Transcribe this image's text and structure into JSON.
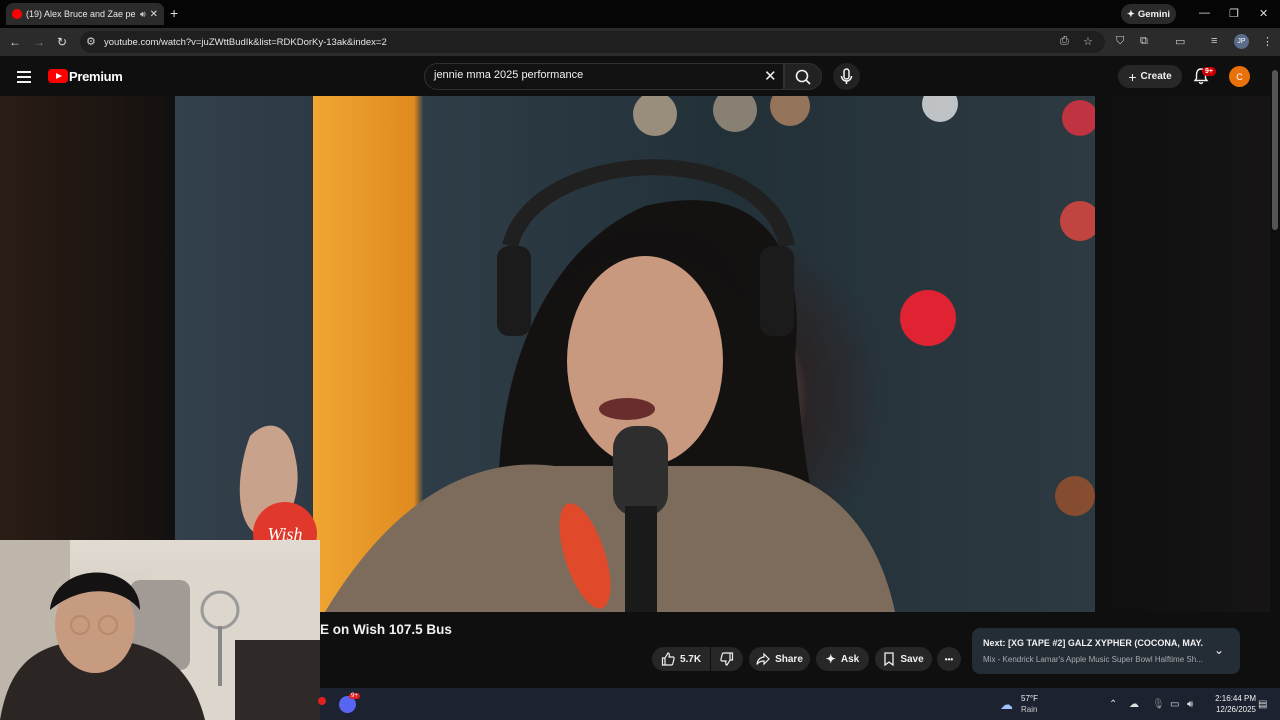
{
  "browser": {
    "tab": {
      "title": "(19) Alex Bruce and Zae pe",
      "close": "✕"
    },
    "new_tab": "+",
    "gemini_label": "Gemini",
    "window": {
      "minimize": "—",
      "restore": "❐",
      "close": "✕"
    },
    "nav": {
      "back": "←",
      "forward": "→",
      "reload": "↻"
    },
    "url": "youtube.com/watch?v=juZWttBudIk&list=RDKDorKy-13ak&index=2",
    "profile_initials": "JP"
  },
  "youtube": {
    "logo_text": "Premium",
    "search": {
      "value": "jennie mma 2025 performance",
      "clear": "✕"
    },
    "create_label": "Create",
    "notifications_badge": "9+",
    "account_initial": "C"
  },
  "video": {
    "title_visible": "E on Wish 107.5 Bus",
    "watermark": "Wish"
  },
  "actions": {
    "likes": "5.7K",
    "share": "Share",
    "ask": "Ask",
    "save": "Save",
    "more": "•••"
  },
  "up_next": {
    "title": "Next: [XG TAPE #2] GALZ XYPHER (COCONA, MAY...",
    "subtitle": "Mix - Kendrick Lamar's Apple Music Super Bowl Halftime Sh..."
  },
  "taskbar": {
    "discord_badge": "9+",
    "weather_temp": "57°F",
    "weather_condition": "Rain",
    "time": "2:16:44 PM",
    "date": "12/26/2025"
  }
}
